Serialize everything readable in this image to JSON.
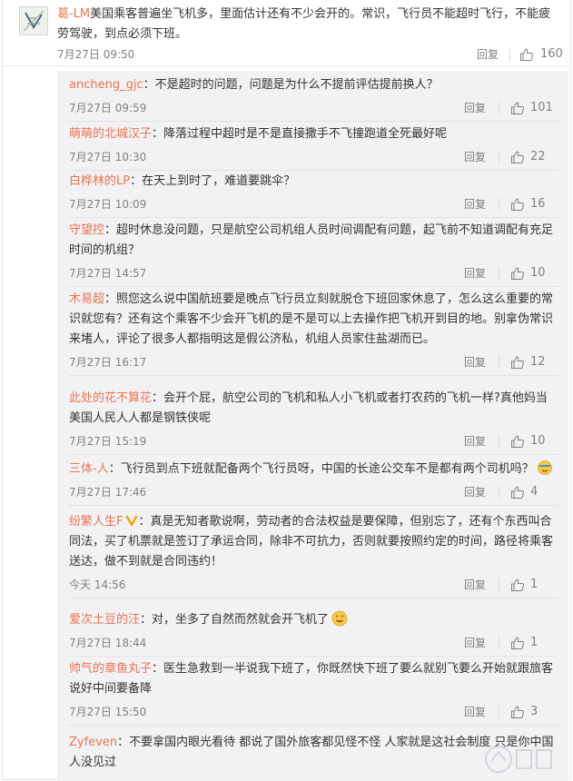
{
  "main_comment": {
    "user": "葛-LM",
    "text_line1": "美国乘客普遍坐飞机多，里面估计还有不少会开的。常识，飞行员不能超时飞行，不能疲",
    "text_line2": "劳驾驶，到点必须下班。",
    "time": "7月27日 09:50",
    "reply_label": "回复",
    "likes": "160"
  },
  "replies": [
    {
      "user": "ancheng_gjc",
      "lines": [
        "：不是超时的问题，问题是为什么不提前评估提前换人？"
      ],
      "time": "7月27日 09:59",
      "reply_label": "回复",
      "likes": "101"
    },
    {
      "user": "萌萌的北城汉子",
      "lines": [
        "：降落过程中超时是不是直接撒手不飞撞跑道全死最好呢"
      ],
      "time": "7月27日 10:30",
      "reply_label": "回复",
      "likes": "22"
    },
    {
      "user": "白桦林的LP",
      "lines": [
        "：在天上到时了，难道要跳伞？"
      ],
      "time": "7月27日 10:09",
      "reply_label": "回复",
      "likes": "16"
    },
    {
      "user": "守望控",
      "lines": [
        "：超时休息没问题，只是航空公司机组人员时间调配有问题，起飞前不知道调配有充足",
        "时间的机组？"
      ],
      "time": "7月27日 14:57",
      "reply_label": "回复",
      "likes": "10"
    },
    {
      "user": "木易超",
      "lines": [
        "：照您这么说中国航班要是晚点飞行员立刻就脱仓下班回家休息了，怎么这么重要的常",
        "识就您有？还有这个乘客不少会开飞机的是不是可以上去操作把飞机开到目的地。别拿伪常识",
        "来堵人，评论了很多人都指明这是假公济私，机组人员家住盐湖而已。"
      ],
      "time": "7月27日 16:17",
      "reply_label": "回复",
      "likes": "12"
    },
    {
      "user": "此处的花不算花",
      "lines": [
        "：会开个屁，航空公司的飞机和私人小飞机或者打农药的飞机一样?真他妈当",
        "美国人民人人都是钢铁侠呢"
      ],
      "time": "7月27日 15:19",
      "reply_label": "回复",
      "likes": "10"
    },
    {
      "user": "三体-人",
      "lines": [
        "：飞行员到点下班就配备两个飞行员呀，中国的长途公交车不是都有两个司机吗？"
      ],
      "time": "7月27日 17:46",
      "reply_label": "回复",
      "likes": "4"
    },
    {
      "user": "纷繁人生F",
      "lines": [
        "：真是无知者歌说啊，劳动者的合法权益是要保障，但别忘了，还有个东西叫合",
        "同法，买了机票就是签订了承运合同，除非不可抗力，否则就要按照约定的时间，路径将乘客",
        "送达，做不到就是合同违约！"
      ],
      "time": "今天 14:56",
      "reply_label": "回复",
      "likes": "1"
    },
    {
      "user": "爱次土豆的汪",
      "lines": [
        "：对，坐多了自然而然就会开飞机了"
      ],
      "time": "7月27日 18:44",
      "reply_label": "回复",
      "likes": "1"
    },
    {
      "user": "帅气的章鱼丸子",
      "lines": [
        "：医生急救到一半说我下班了，你既然快下班了要么就别飞要么开始就跟旅客",
        "说好中间要备降"
      ],
      "time": "7月27日 15:50",
      "reply_label": "回复",
      "likes": "3"
    },
    {
      "user": "Zyfeven",
      "lines": [
        "：不要拿国内眼光看待 都说了国外旅客都见怪不怪 人家就是这社会制度 只是你中国",
        "人没见过"
      ],
      "time": "",
      "reply_label": "",
      "likes": ""
    }
  ],
  "colors": {
    "username": "#eb7350",
    "text": "#333333",
    "meta": "#808080",
    "panel": "#f2f2f5"
  },
  "icons": {
    "like": "thumbs-up-icon",
    "vip": "vip-badge-icon",
    "emoji": "emoji-icon"
  }
}
